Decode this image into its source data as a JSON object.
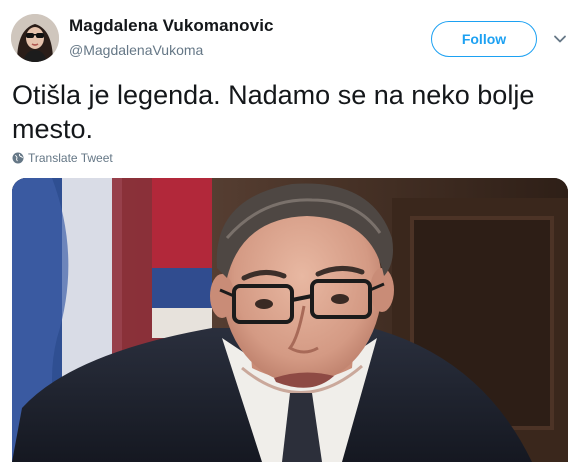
{
  "user": {
    "display_name": "Magdalena Vukomanovic",
    "handle": "@MagdalenaVukoma"
  },
  "actions": {
    "follow_label": "Follow",
    "menu_icon": "chevron-down-icon"
  },
  "tweet": {
    "text": "Otišla je legenda. Nadamo se na neko bolje mesto.",
    "translate_label": "Translate Tweet"
  },
  "colors": {
    "accent": "#1da1f2",
    "secondary_text": "#657786",
    "primary_text": "#14171a"
  }
}
